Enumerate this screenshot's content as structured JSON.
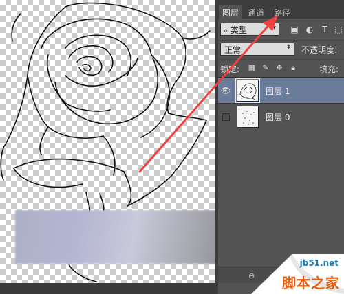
{
  "layers_panel": {
    "tabs": [
      {
        "label": "图层",
        "active": true
      },
      {
        "label": "通道",
        "active": false
      },
      {
        "label": "路径",
        "active": false
      }
    ],
    "filter": {
      "search_icon": "search-icon",
      "selected": "类型"
    },
    "filter_icons": [
      "image-filter-icon",
      "adjustment-filter-icon",
      "type-filter-icon",
      "shape-filter-icon"
    ],
    "blend_mode": "正常",
    "opacity_label": "不透明度:",
    "lock_label": "锁定:",
    "lock_icons": [
      "lock-transparent-icon",
      "lock-paint-icon",
      "lock-move-icon",
      "lock-all-icon"
    ],
    "fill_label": "填充:",
    "layers": [
      {
        "name": "图层 1",
        "visible": true,
        "selected": true
      },
      {
        "name": "图层 0",
        "visible": false,
        "selected": false
      }
    ]
  },
  "canvas": {
    "content": "rose line drawing on transparent layer"
  },
  "annotation": {
    "color": "#f04040"
  },
  "watermark": {
    "site": "jb51.net",
    "brand": "脚本之家"
  },
  "colors": {
    "panel_bg": "#535353",
    "selected_layer": "#6a7c99",
    "tab_bar": "#3d3d3d"
  }
}
